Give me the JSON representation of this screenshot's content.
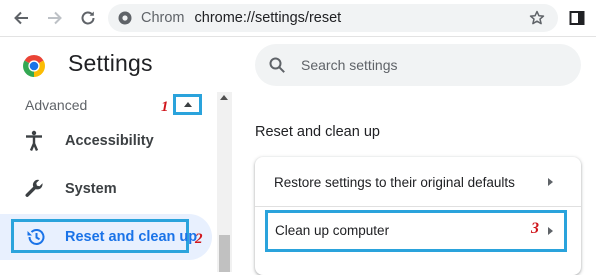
{
  "browser": {
    "omnibox": {
      "site_chip": "Chrom",
      "url": "chrome://settings/reset"
    },
    "icons": [
      "back-arrow-icon",
      "forward-arrow-icon",
      "reload-icon",
      "site-info-icon",
      "bookmark-star-icon",
      "side-panel-icon"
    ]
  },
  "header": {
    "title": "Settings"
  },
  "sidebar": {
    "section_label": "Advanced",
    "items": [
      {
        "label": "Accessibility",
        "icon": "accessibility-icon",
        "selected": false
      },
      {
        "label": "System",
        "icon": "wrench-icon",
        "selected": false
      },
      {
        "label": "Reset and clean up",
        "icon": "reset-history-icon",
        "selected": true
      }
    ]
  },
  "search": {
    "placeholder": "Search settings"
  },
  "main": {
    "section_title": "Reset and clean up",
    "rows": [
      {
        "label": "Restore settings to their original defaults"
      },
      {
        "label": "Clean up computer"
      }
    ]
  },
  "annotations": {
    "step1": "1",
    "step2": "2",
    "step3": "3"
  },
  "colors": {
    "highlight_box": "#2aa3dc",
    "step_number": "#d0161c",
    "selected_text": "#1a73e8",
    "selected_bg": "#e8f0fe"
  }
}
